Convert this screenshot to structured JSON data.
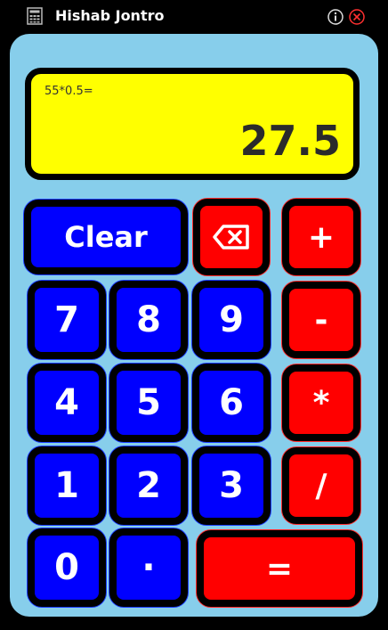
{
  "window": {
    "title": "Hishab Jontro",
    "app_icon": "calculator-icon",
    "info_icon": "info-icon",
    "close_icon": "close-icon"
  },
  "display": {
    "expression": "55*0.5=",
    "result": "27.5"
  },
  "keys": {
    "clear": "Clear",
    "backspace_icon": "backspace-icon",
    "plus": "+",
    "minus": "-",
    "multiply": "*",
    "divide": "/",
    "equals": "=",
    "digit_7": "7",
    "digit_8": "8",
    "digit_9": "9",
    "digit_4": "4",
    "digit_5": "5",
    "digit_6": "6",
    "digit_1": "1",
    "digit_2": "2",
    "digit_3": "3",
    "digit_0": "0",
    "dot": "·"
  },
  "colors": {
    "panel": "#87CEEB",
    "display": "#FFFF00",
    "number_key": "#0000FF",
    "operator_key": "#FF0000",
    "titlebar": "#000000"
  }
}
